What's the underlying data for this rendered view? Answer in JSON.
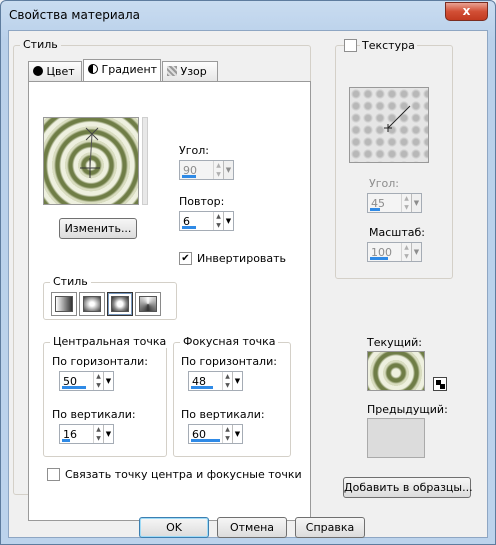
{
  "window": {
    "title": "Свойства материала",
    "close_glyph": "x"
  },
  "style_group": {
    "title": "Стиль",
    "tabs": [
      {
        "label": "Цвет",
        "icon": "filled-circle-icon"
      },
      {
        "label": "Градиент",
        "icon": "half-circle-icon"
      },
      {
        "label": "Узор",
        "icon": "pattern-grid-icon"
      }
    ],
    "active_tab": "Градиент"
  },
  "gradient": {
    "angle_label": "Угол:",
    "angle_value": "90",
    "repeat_label": "Повтор:",
    "repeat_value": "6",
    "edit_button": "Изменить...",
    "invert_label": "Инвертировать",
    "invert_checked": true,
    "style_label": "Стиль",
    "style_options": [
      "linear",
      "rectangular",
      "sunburst",
      "radial"
    ],
    "selected_style": "sunburst",
    "center_point": {
      "title": "Центральная точка",
      "h_label": "По горизонтали:",
      "h_value": "50",
      "v_label": "По вертикали:",
      "v_value": "16"
    },
    "focal_point": {
      "title": "Фокусная точка",
      "h_label": "По горизонтали:",
      "h_value": "48",
      "v_label": "По вертикали:",
      "v_value": "60"
    },
    "link_label": "Связать точку центра и фокусные точки",
    "link_checked": false
  },
  "texture": {
    "label": "Текстура",
    "checked": false,
    "angle_label": "Угол:",
    "angle_value": "45",
    "scale_label": "Масштаб:",
    "scale_value": "100"
  },
  "current_label": "Текущий:",
  "previous_label": "Предыдущий:",
  "add_to_swatches": "Добавить в образцы...",
  "buttons": {
    "ok": "OK",
    "cancel": "Отмена",
    "help": "Справка"
  },
  "colors": {
    "accent": "#2f8ae6",
    "gradient_dark": "#6f7d46",
    "gradient_light": "#eef0df"
  }
}
